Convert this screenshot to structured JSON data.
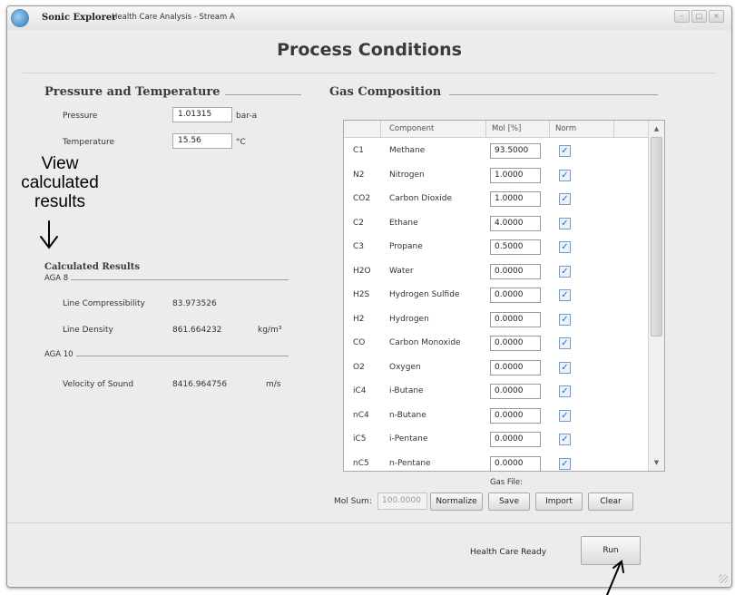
{
  "window": {
    "app_name": "Sonic Explorer",
    "subtitle": "Health Care Analysis - Stream A",
    "page_title": "Process Conditions"
  },
  "pressure_temp": {
    "heading": "Pressure and Temperature",
    "pressure_label": "Pressure",
    "pressure_value": "1.01315",
    "pressure_unit": "bar-a",
    "temperature_label": "Temperature",
    "temperature_value": "15.56",
    "temperature_unit": "°C"
  },
  "calculated": {
    "heading": "Calculated Results",
    "aga8_label": "AGA 8",
    "compressibility_label": "Line Compressibility",
    "compressibility_value": "83.973526",
    "density_label": "Line Density",
    "density_value": "861.664232",
    "density_unit": "kg/m³",
    "aga10_label": "AGA 10",
    "sound_label": "Velocity of Sound",
    "sound_value": "8416.964756",
    "sound_unit": "m/s"
  },
  "gas": {
    "heading": "Gas Composition",
    "columns": [
      "Component",
      "Mol [%]",
      "Norm"
    ],
    "rows": [
      {
        "code": "C1",
        "name": "Methane",
        "mol": "93.5000",
        "norm": true
      },
      {
        "code": "N2",
        "name": "Nitrogen",
        "mol": "1.0000",
        "norm": true
      },
      {
        "code": "CO2",
        "name": "Carbon Dioxide",
        "mol": "1.0000",
        "norm": true
      },
      {
        "code": "C2",
        "name": "Ethane",
        "mol": "4.0000",
        "norm": true
      },
      {
        "code": "C3",
        "name": "Propane",
        "mol": "0.5000",
        "norm": true
      },
      {
        "code": "H2O",
        "name": "Water",
        "mol": "0.0000",
        "norm": true
      },
      {
        "code": "H2S",
        "name": "Hydrogen Sulfide",
        "mol": "0.0000",
        "norm": true
      },
      {
        "code": "H2",
        "name": "Hydrogen",
        "mol": "0.0000",
        "norm": true
      },
      {
        "code": "CO",
        "name": "Carbon Monoxide",
        "mol": "0.0000",
        "norm": true
      },
      {
        "code": "O2",
        "name": "Oxygen",
        "mol": "0.0000",
        "norm": true
      },
      {
        "code": "iC4",
        "name": "i-Butane",
        "mol": "0.0000",
        "norm": true
      },
      {
        "code": "nC4",
        "name": "n-Butane",
        "mol": "0.0000",
        "norm": true
      },
      {
        "code": "iC5",
        "name": "i-Pentane",
        "mol": "0.0000",
        "norm": true
      },
      {
        "code": "nC5",
        "name": "n-Pentane",
        "mol": "0.0000",
        "norm": true
      }
    ],
    "gas_file_label": "Gas File:",
    "mol_sum_label": "Mol Sum:",
    "mol_sum_value": "100.0000",
    "buttons": {
      "normalize": "Normalize",
      "save": "Save",
      "import": "Import",
      "clear": "Clear"
    }
  },
  "footer": {
    "status": "Health Care Ready",
    "run_label": "Run"
  },
  "annotation": {
    "line1": "View",
    "line2": "calculated",
    "line3": "results"
  },
  "colors": {
    "window_bg": "#ececec",
    "check_accent": "#2b6cb0"
  }
}
